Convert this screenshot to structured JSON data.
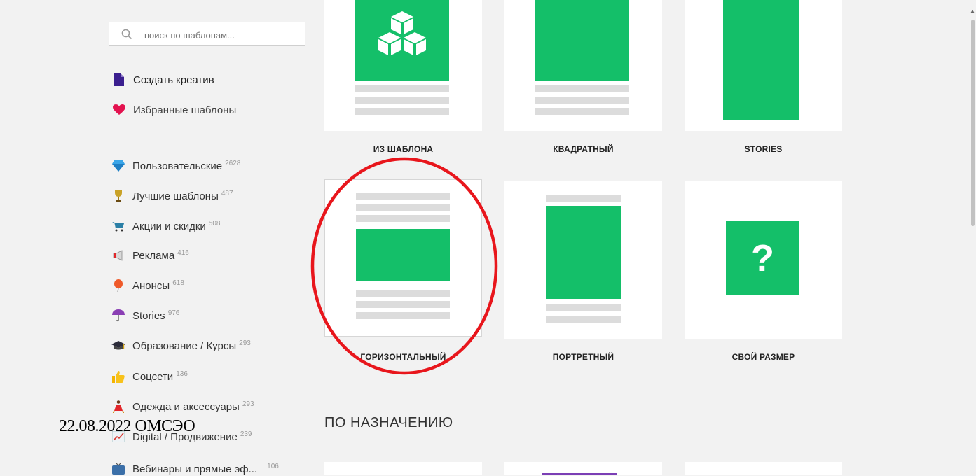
{
  "search": {
    "placeholder": "поиск по шаблонам...",
    "value": ""
  },
  "main_links": [
    {
      "label": "Создать креатив",
      "icon": "document-icon"
    },
    {
      "label": "Избранные шаблоны",
      "icon": "heart-icon"
    }
  ],
  "categories": [
    {
      "label": "Пользовательские",
      "count": "2628",
      "icon": "diamond-icon"
    },
    {
      "label": "Лучшие шаблоны",
      "count": "487",
      "icon": "trophy-icon"
    },
    {
      "label": "Акции и скидки",
      "count": "508",
      "icon": "cart-icon"
    },
    {
      "label": "Реклама",
      "count": "416",
      "icon": "megaphone-icon"
    },
    {
      "label": "Анонсы",
      "count": "618",
      "icon": "balloon-icon"
    },
    {
      "label": "Stories",
      "count": "976",
      "icon": "umbrella-icon"
    },
    {
      "label": "Образование / Курсы",
      "count": "293",
      "icon": "graduation-cap-icon"
    },
    {
      "label": "Соцсети",
      "count": "136",
      "icon": "thumbs-up-icon"
    },
    {
      "label": "Одежда и аксессуары",
      "count": "293",
      "icon": "dancer-icon"
    },
    {
      "label": "Digital / Продвижение",
      "count": "239",
      "icon": "chart-icon"
    },
    {
      "label": "Вебинары и прямые эф...",
      "count": "106",
      "icon": "tv-icon"
    }
  ],
  "formats": [
    {
      "label": "ИЗ ШАБЛОНА",
      "icon": "cubes-icon"
    },
    {
      "label": "КВАДРАТНЫЙ"
    },
    {
      "label": "STORIES"
    },
    {
      "label": "ГОРИЗОНТАЛЬНЫЙ"
    },
    {
      "label": "ПОРТРЕТНЫЙ"
    },
    {
      "label": "СВОЙ РАЗМЕР",
      "symbol": "?"
    }
  ],
  "section_title": "ПО НАЗНАЧЕНИЮ",
  "stamp": "22.08.2022 ОМСЭО",
  "colors": {
    "accent": "#14bf69",
    "highlight": "#e8161c",
    "purple": "#7b3fb5"
  }
}
